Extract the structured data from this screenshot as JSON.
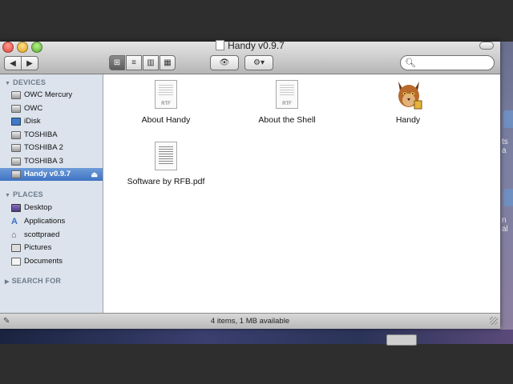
{
  "window": {
    "title": "Handy v0.9.7",
    "status": "4 items, 1 MB available"
  },
  "toolbar": {
    "back_icon": "◀",
    "forward_icon": "▶",
    "view_icons": [
      "⊞",
      "≡",
      "▥",
      "▦"
    ],
    "quicklook_icon": "👁",
    "action_icon": "⚙▾",
    "search_placeholder": ""
  },
  "sidebar": {
    "devices_label": "DEVICES",
    "places_label": "PLACES",
    "search_label": "SEARCH FOR",
    "devices": [
      {
        "label": "OWC Mercury",
        "icon": "drive-icon"
      },
      {
        "label": "OWC",
        "icon": "drive-icon"
      },
      {
        "label": "iDisk",
        "icon": "idisk-icon"
      },
      {
        "label": "TOSHIBA",
        "icon": "drive-icon"
      },
      {
        "label": "TOSHIBA 2",
        "icon": "drive-icon"
      },
      {
        "label": "TOSHIBA 3",
        "icon": "drive-icon"
      },
      {
        "label": "Handy v0.9.7",
        "icon": "disk-image-icon",
        "selected": true,
        "eject": "⏏"
      }
    ],
    "places": [
      {
        "label": "Desktop",
        "icon": "desktop-icon"
      },
      {
        "label": "Applications",
        "icon": "applications-icon"
      },
      {
        "label": "scottpraed",
        "icon": "home-icon"
      },
      {
        "label": "Pictures",
        "icon": "pictures-icon"
      },
      {
        "label": "Documents",
        "icon": "documents-icon"
      }
    ]
  },
  "files": [
    {
      "name": "About Handy",
      "kind": "RTF"
    },
    {
      "name": "About the Shell",
      "kind": "RTF"
    },
    {
      "name": "Handy",
      "kind": "app"
    },
    {
      "name": "Software by RFB.pdf",
      "kind": "pdf"
    }
  ],
  "background": {
    "partial_text_1": "ts a",
    "partial_text_2": "n al"
  },
  "colors": {
    "selection": "#3f73c4",
    "sidebar_bg": "#dce3ec"
  }
}
